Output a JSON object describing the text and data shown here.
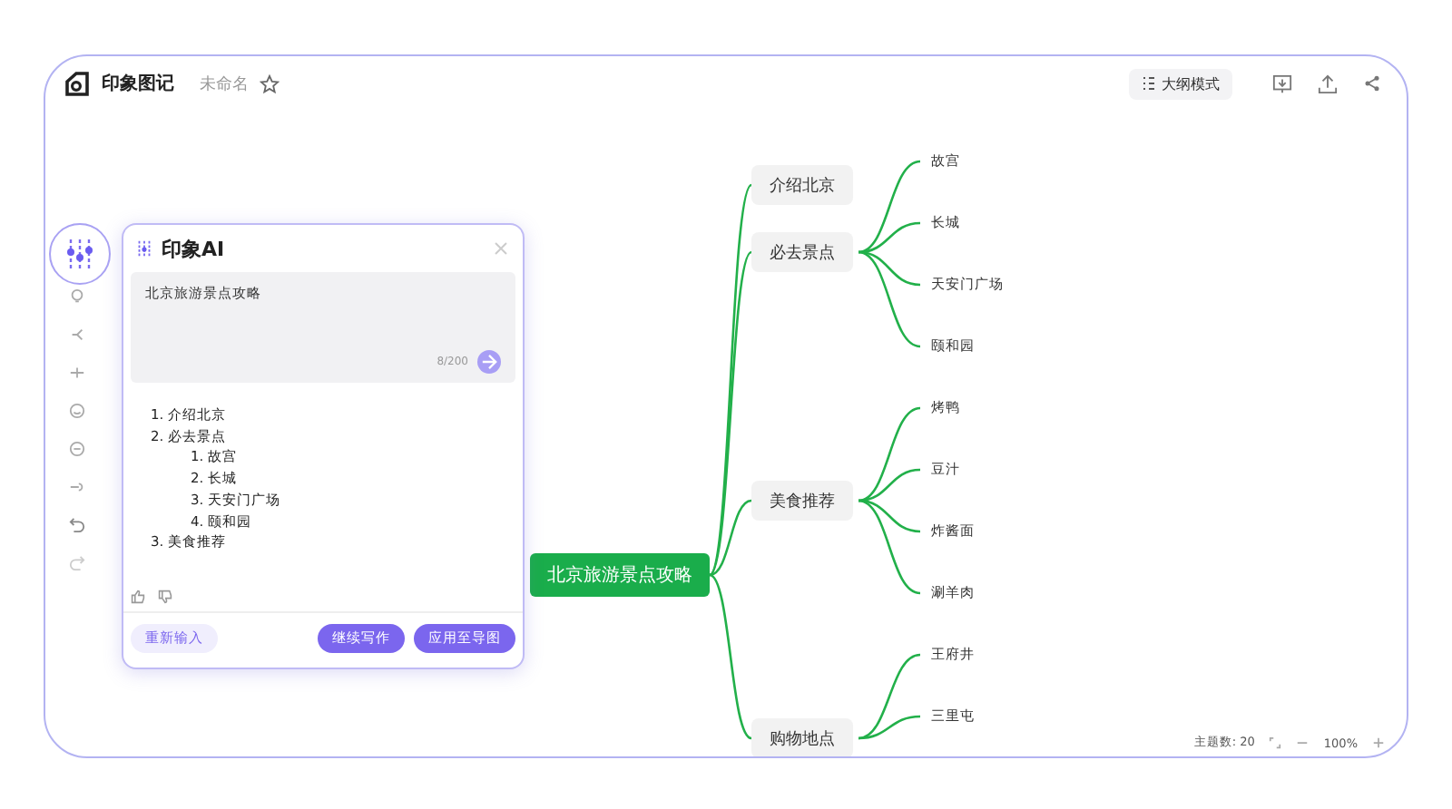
{
  "app": {
    "name": "印象图记",
    "doc_title": "未命名"
  },
  "toolbar": {
    "outline_button": "大纲模式"
  },
  "mindmap": {
    "root": {
      "text": "北京旅游景点攻略",
      "children": [
        {
          "text": "介绍北京"
        },
        {
          "text": "必去景点",
          "children": [
            {
              "text": "故宫"
            },
            {
              "text": "长城"
            },
            {
              "text": "天安门广场"
            },
            {
              "text": "颐和园"
            }
          ]
        },
        {
          "text": "美食推荐",
          "children": [
            {
              "text": "烤鸭"
            },
            {
              "text": "豆汁"
            },
            {
              "text": "炸酱面"
            },
            {
              "text": "涮羊肉"
            }
          ]
        },
        {
          "text": "购物地点",
          "children": [
            {
              "text": "王府井"
            },
            {
              "text": "三里屯"
            }
          ]
        }
      ]
    }
  },
  "ai_panel": {
    "title": "印象AI",
    "prompt": "北京旅游景点攻略",
    "counter": "8/200",
    "result": [
      {
        "text": "1. 介绍北京"
      },
      {
        "text": "2. 必去景点",
        "children": [
          {
            "text": "1. 故宫"
          },
          {
            "text": "2. 长城"
          },
          {
            "text": "3. 天安门广场"
          },
          {
            "text": "4. 颐和园"
          }
        ]
      },
      {
        "text": "3. 美食推荐"
      }
    ],
    "buttons": [
      {
        "label": "重新输入",
        "kind": "secondary"
      },
      {
        "label": "继续写作",
        "kind": "primary"
      },
      {
        "label": "应用至导图",
        "kind": "primary"
      }
    ]
  },
  "status_bar": {
    "topic_count": "主题数: 20",
    "zoom": "100%"
  }
}
